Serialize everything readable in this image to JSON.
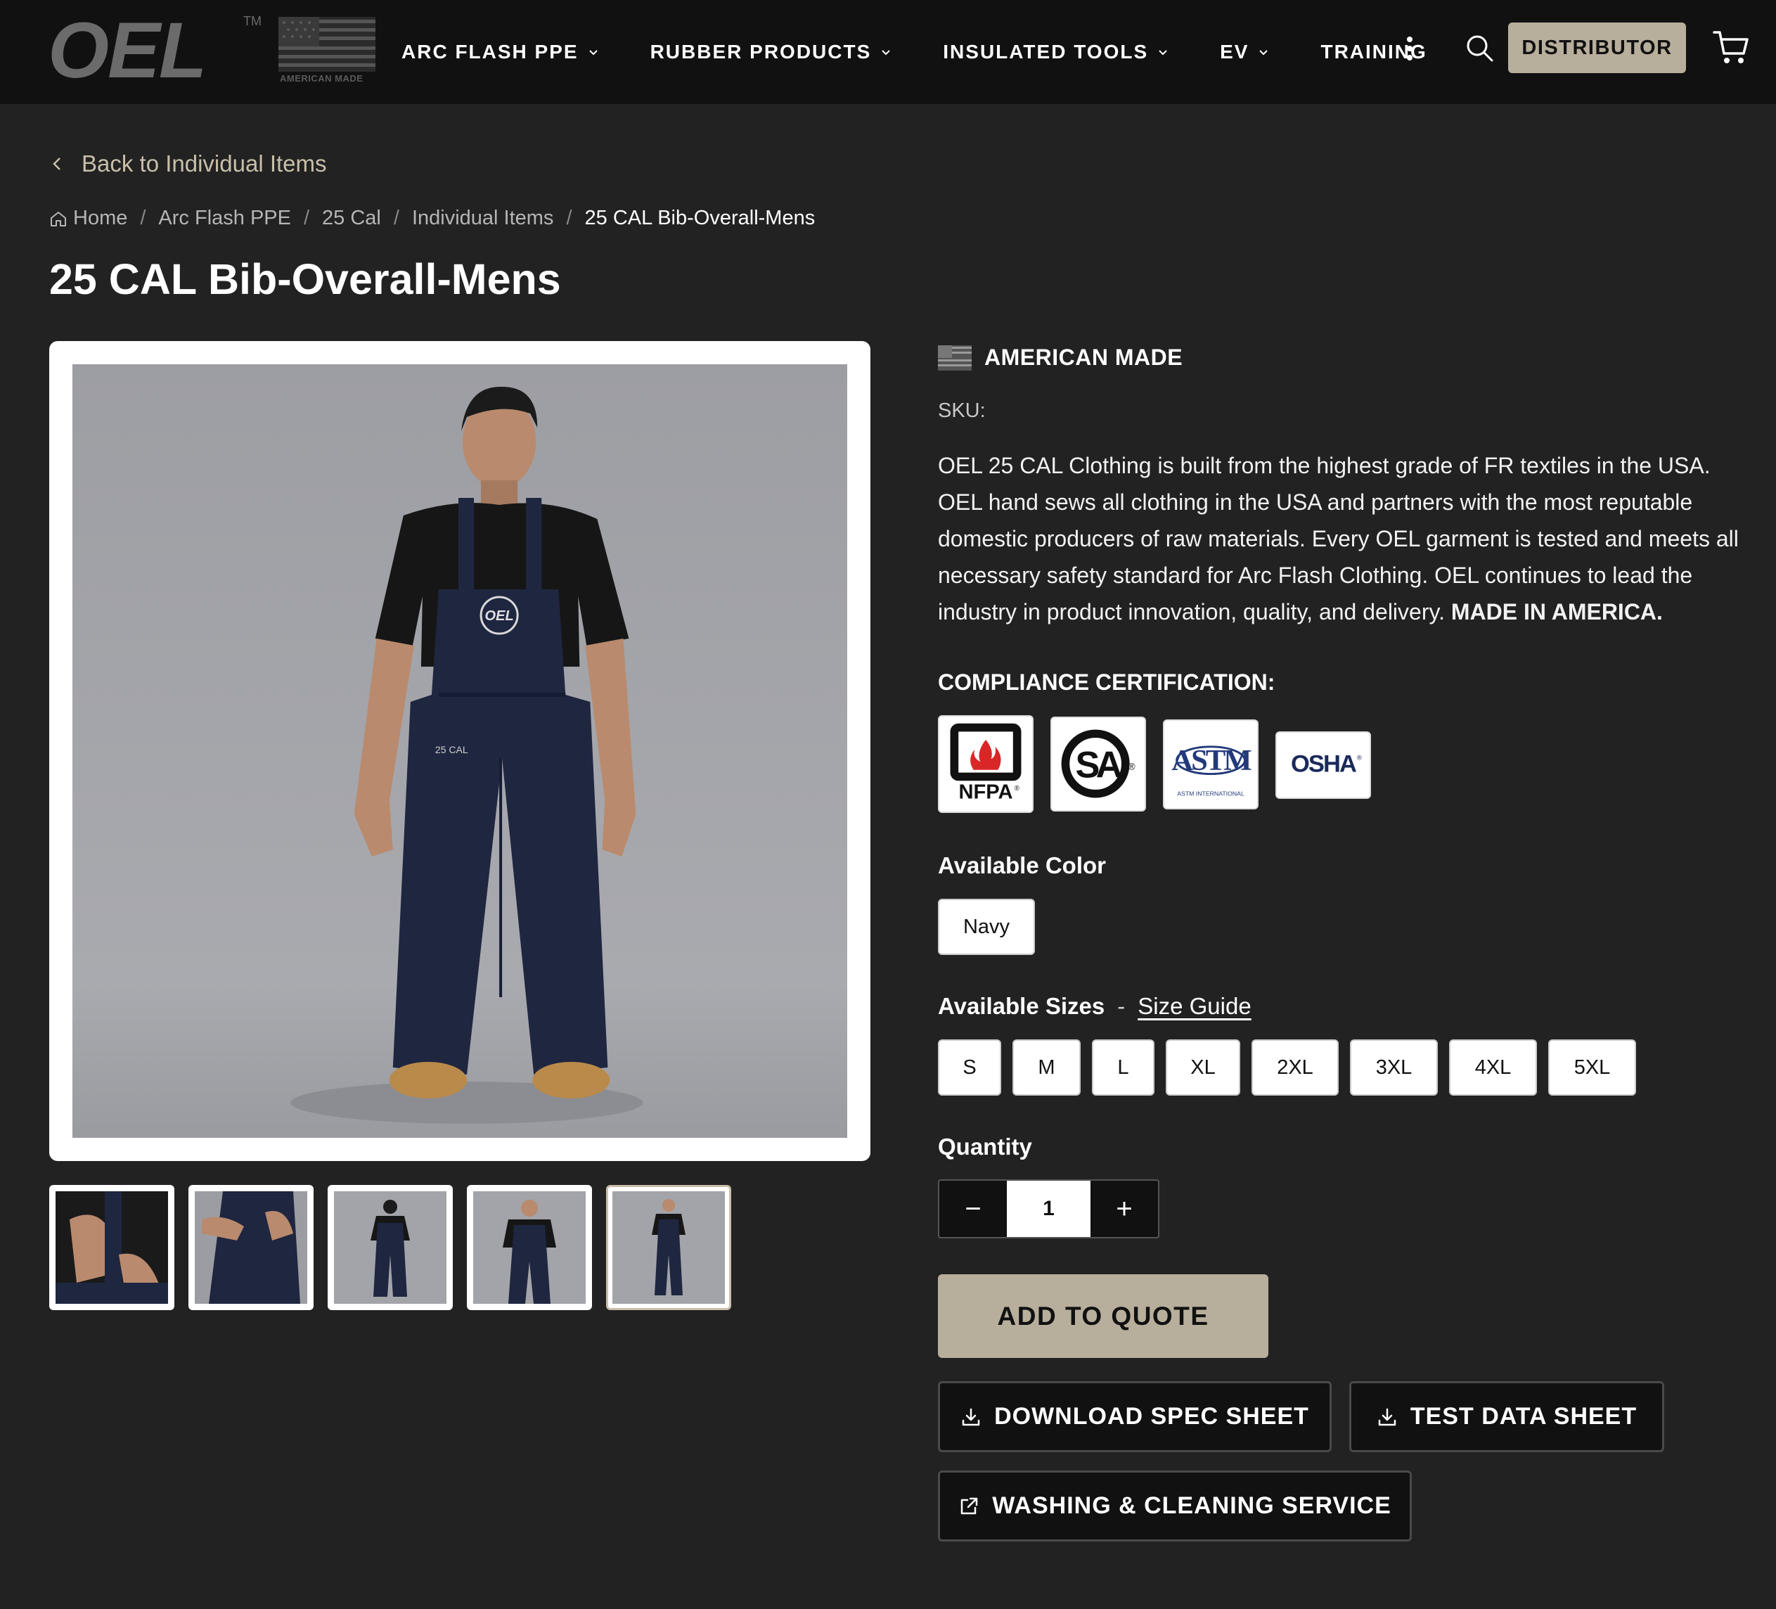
{
  "header": {
    "logo_text": "OEL",
    "logo_tm": "TM",
    "logo_flag_caption": "AMERICAN MADE",
    "nav": [
      {
        "label": "ARC FLASH PPE",
        "has_dropdown": true
      },
      {
        "label": "RUBBER PRODUCTS",
        "has_dropdown": true
      },
      {
        "label": "INSULATED TOOLS",
        "has_dropdown": true
      },
      {
        "label": "EV",
        "has_dropdown": true
      },
      {
        "label": "TRAINING",
        "has_dropdown": false
      }
    ],
    "more_icon": "kebab-vertical-icon",
    "search_icon": "search-icon",
    "distributor_label": "DISTRIBUTOR",
    "cart_icon": "cart-icon"
  },
  "back_link": "Back to Individual Items",
  "breadcrumb": [
    "Home",
    "Arc Flash PPE",
    "25 Cal",
    "Individual Items",
    "25 CAL Bib-Overall-Mens"
  ],
  "product": {
    "title": "25 CAL Bib-Overall-Mens",
    "american_made": "AMERICAN MADE",
    "sku_label": "SKU:",
    "description": "OEL 25 CAL Clothing is built from the highest grade of FR textiles in the USA. OEL hand sews all clothing in the USA and partners with the most reputable domestic producers of raw materials. Every OEL garment is tested and meets all necessary safety standard for Arc Flash Clothing. OEL continues to lead the industry in product innovation, quality, and delivery.",
    "description_emphasis": "MADE IN AMERICA.",
    "compliance_title": "COMPLIANCE CERTIFICATION:",
    "certifications": [
      {
        "name": "NFPA",
        "mark": "NFPA",
        "sup": "®"
      },
      {
        "name": "CSA",
        "mark": "SA",
        "sup": "®"
      },
      {
        "name": "ASTM",
        "mark": "ASTM",
        "caption": "ASTM INTERNATIONAL"
      },
      {
        "name": "OSHA",
        "mark": "OSHA",
        "sup": "®"
      }
    ],
    "color_title": "Available Color",
    "colors": [
      "Navy"
    ],
    "sizes_title": "Available Sizes",
    "sizes_sep": "-",
    "size_guide": "Size Guide",
    "sizes": [
      "S",
      "M",
      "L",
      "XL",
      "2XL",
      "3XL",
      "4XL",
      "5XL"
    ],
    "quantity_title": "Quantity",
    "quantity": "1",
    "minus_label": "−",
    "plus_label": "+",
    "add_to_quote": "ADD TO QUOTE",
    "download_spec": "DOWNLOAD SPEC SHEET",
    "test_data": "TEST DATA SHEET",
    "washing": "WASHING & CLEANING SERVICE",
    "garment_logo": "OEL",
    "garment_text": "25 CAL"
  },
  "gallery": {
    "active_thumbnail": 5,
    "thumbnail_count": 5
  },
  "colors": {
    "header_bg": "#111111",
    "page_bg": "#222222",
    "accent_tan": "#b8ae9c",
    "link_tan": "#c9bfa9",
    "garment_navy": "#1f2640"
  }
}
